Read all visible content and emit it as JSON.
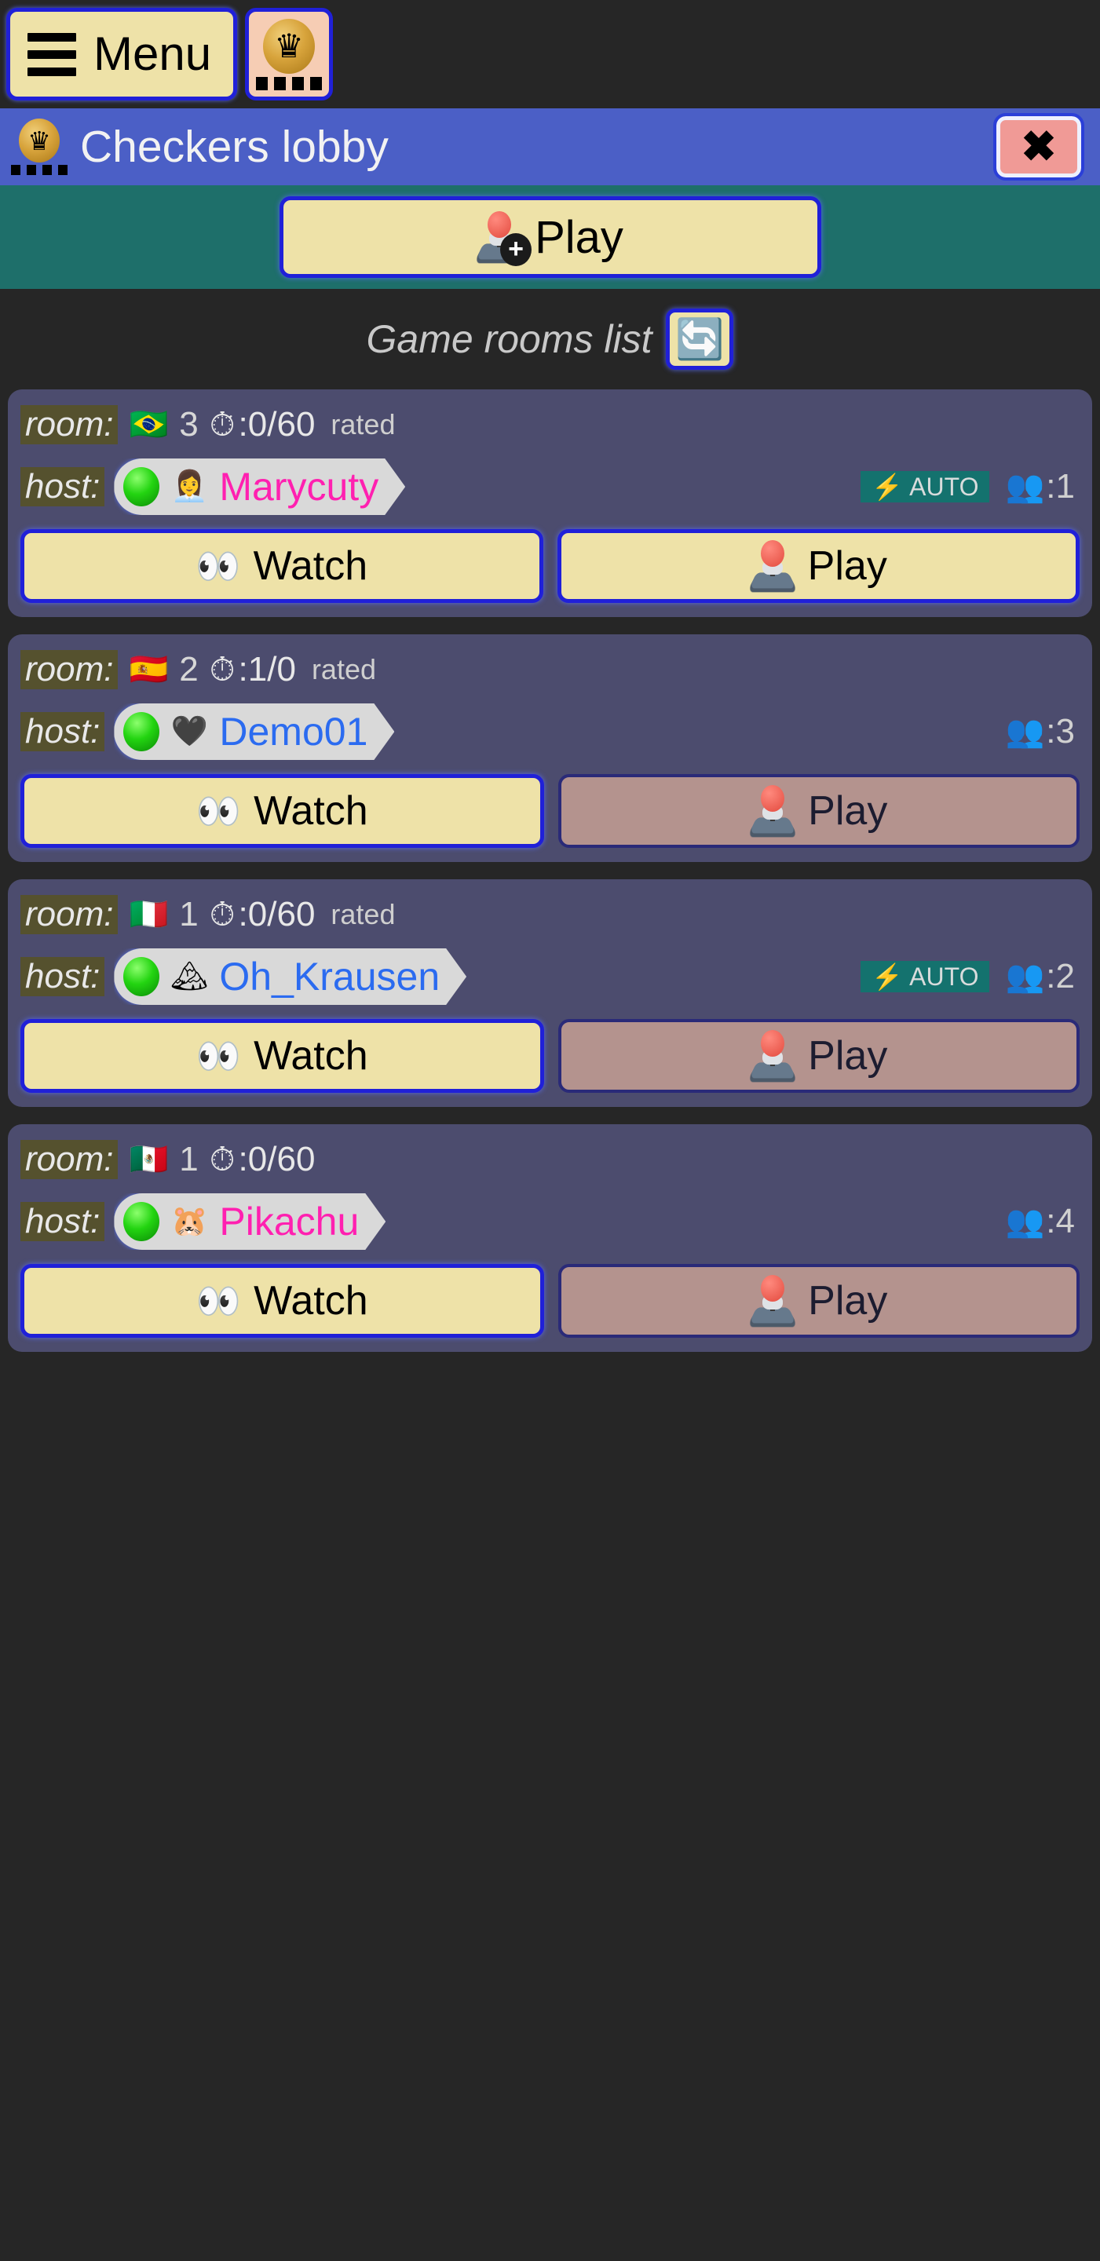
{
  "topbar": {
    "menu_label": "Menu",
    "menu_icon": "hamburger-icon",
    "app_icon": "checkers-crown-icon"
  },
  "titlebar": {
    "title": "Checkers lobby",
    "icon": "checkers-crown-icon",
    "close_label": "✖"
  },
  "play_bar": {
    "play_label": "Play",
    "icon": "joystick-add-icon"
  },
  "rooms_header": {
    "title": "Game rooms list",
    "refresh_icon": "🔄"
  },
  "labels": {
    "room": "room:",
    "host": "host:",
    "rated": "rated",
    "auto": "AUTO",
    "watch": "Watch",
    "play": "Play",
    "timer_icon": "⏱",
    "people_icon": "👥",
    "eyes_icon": "👀",
    "bolt_icon": "⚡"
  },
  "colors": {
    "page_bg": "#262626",
    "titlebar_bg": "#4b5fc6",
    "teal_bar": "#1e6f6a",
    "card_bg": "#4c4c6e",
    "button_cream": "#eee2a8",
    "button_disabled": "#b4938e",
    "button_border": "#2020d8",
    "close_bg": "#f09a96",
    "auto_bg": "#14726e",
    "name_pink": "#ff20b0",
    "name_blue": "#2b6bf0",
    "tag_bg": "#55512e"
  },
  "rooms": [
    {
      "flag": "🇧🇷",
      "room_number": "3",
      "time": ":0/60",
      "rated": "rated",
      "host_name": "Marycuty",
      "host_color": "pink",
      "avatar": "👩‍💼",
      "status": "online",
      "auto": true,
      "players": ":1",
      "watch_label": "Watch",
      "play_label": "Play",
      "play_enabled": true
    },
    {
      "flag": "🇪🇸",
      "room_number": "2",
      "time": ":1/0",
      "rated": "rated",
      "host_name": "Demo01",
      "host_color": "blue",
      "avatar": "🖤",
      "status": "online",
      "auto": false,
      "players": ":3",
      "watch_label": "Watch",
      "play_label": "Play",
      "play_enabled": false
    },
    {
      "flag": "🇮🇹",
      "room_number": "1",
      "time": ":0/60",
      "rated": "rated",
      "host_name": "Oh_Krausen",
      "host_color": "blue",
      "avatar": "🏔",
      "status": "online",
      "auto": true,
      "players": ":2",
      "watch_label": "Watch",
      "play_label": "Play",
      "play_enabled": false
    },
    {
      "flag": "🇲🇽",
      "room_number": "1",
      "time": ":0/60",
      "rated": "",
      "host_name": "Pikachu",
      "host_color": "pink",
      "avatar": "🐹",
      "status": "online",
      "auto": false,
      "players": ":4",
      "watch_label": "Watch",
      "play_label": "Play",
      "play_enabled": false
    }
  ]
}
